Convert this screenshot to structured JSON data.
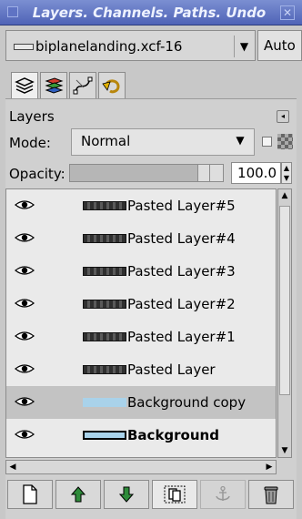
{
  "window": {
    "title": "Layers. Channels. Paths. Undo"
  },
  "image_selector": {
    "label": "biplanelanding.xcf-16"
  },
  "auto_button": "Auto",
  "tabs": [
    "layers-tab",
    "channels-tab",
    "paths-tab",
    "undo-tab"
  ],
  "panel": {
    "heading": "Layers",
    "mode_label": "Mode:",
    "mode_value": "Normal",
    "opacity_label": "Opacity:",
    "opacity_value": "100.0",
    "opacity_fraction": 1.0
  },
  "layers": [
    {
      "name": "Pasted Layer#5",
      "visible": true
    },
    {
      "name": "Pasted Layer#4",
      "visible": true
    },
    {
      "name": "Pasted Layer#3",
      "visible": true
    },
    {
      "name": "Pasted Layer#2",
      "visible": true
    },
    {
      "name": "Pasted Layer#1",
      "visible": true
    },
    {
      "name": "Pasted Layer",
      "visible": true
    },
    {
      "name": "Background copy",
      "visible": true,
      "selected": true
    },
    {
      "name": "Background",
      "visible": true,
      "bold": true
    }
  ],
  "toolbar": {
    "buttons": [
      "new-layer",
      "raise-layer",
      "lower-layer",
      "duplicate-layer",
      "anchor-layer",
      "delete-layer"
    ]
  },
  "colors": {
    "title_bar": "#5a6ebf",
    "selected_row": "#c3c3c3",
    "thumbnail_blue": "#a9d2ea"
  }
}
